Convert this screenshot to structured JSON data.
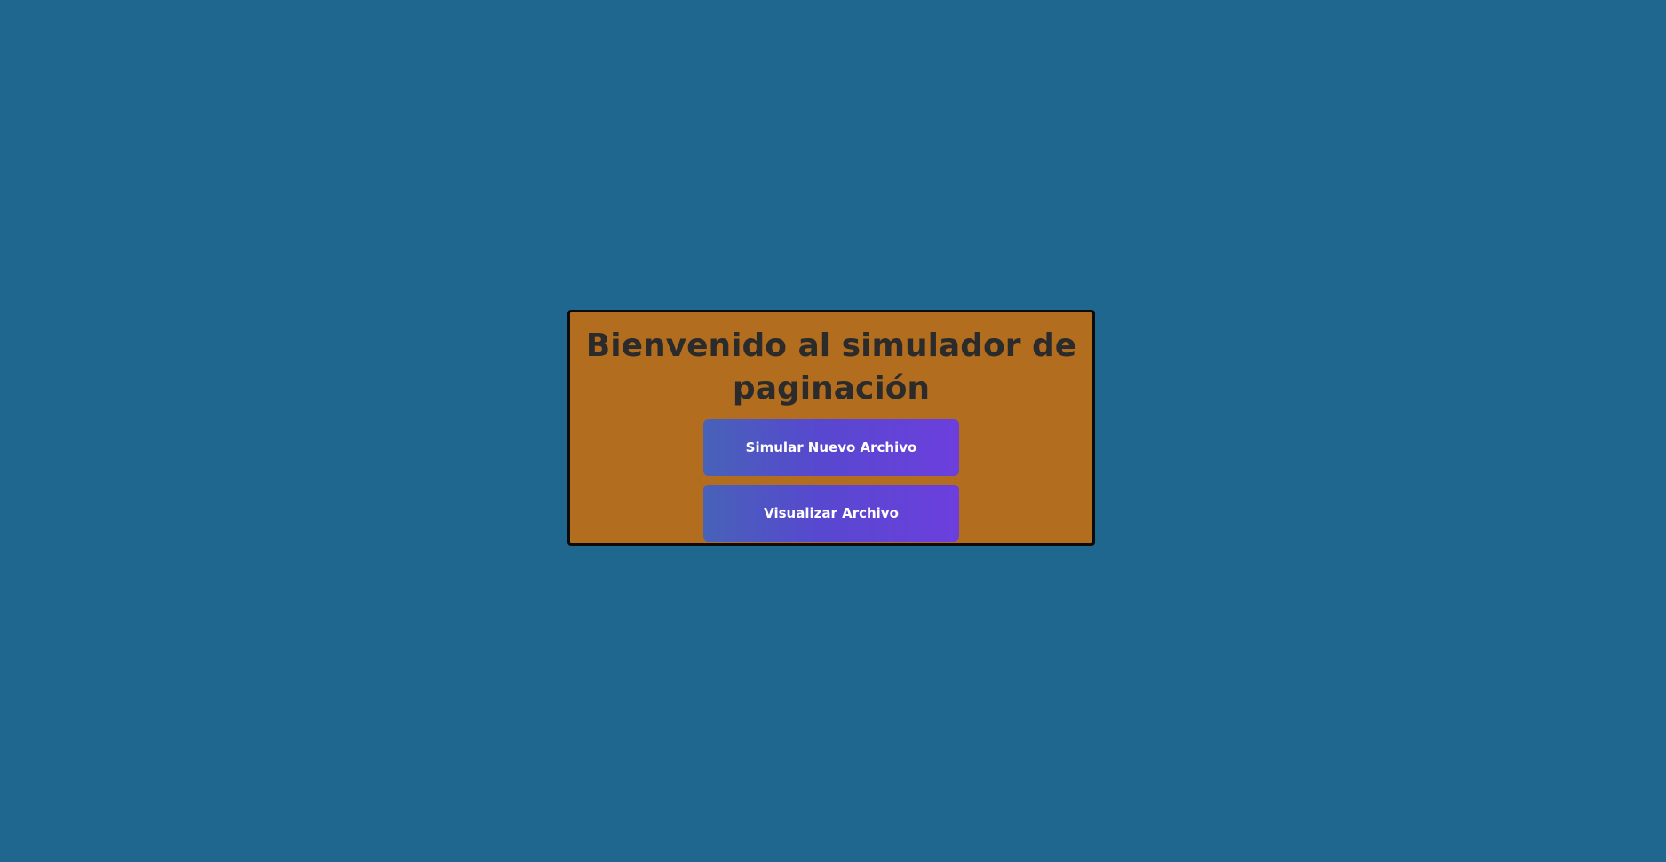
{
  "card": {
    "title": "Bienvenido al simulador de paginación"
  },
  "buttons": {
    "simulate_label": "Simular Nuevo Archivo",
    "view_label": "Visualizar Archivo"
  },
  "colors": {
    "page_background": "#1f678f",
    "card_background": "#b26d1f",
    "card_border": "#0b0b0b",
    "title_text": "#2b2b2b",
    "button_gradient_start": "#4762b8",
    "button_gradient_end": "#6c3fdd",
    "button_text": "#ffffff"
  }
}
